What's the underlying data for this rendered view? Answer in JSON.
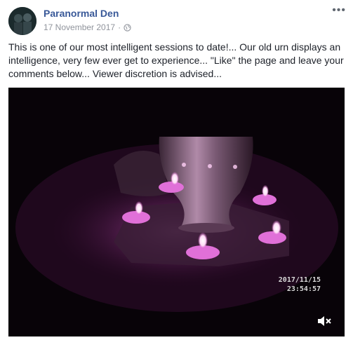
{
  "post": {
    "page_name": "Paranormal Den",
    "date": "17 November 2017",
    "separator": "·",
    "privacy_icon": "globe-icon",
    "more_icon": "more-dots-icon",
    "text": "This is one of our most intelligent sessions to date!... Our old urn displays an intelligence, very few ever get to experience... \"Like\" the page and leave your comments below... Viewer discretion is advised..."
  },
  "video": {
    "date_overlay": "2017/11/15",
    "time_overlay": "23:54:57",
    "mute_icon": "volume-muted-icon"
  },
  "colors": {
    "page_name": "#385898",
    "meta": "#90949c",
    "candle_glow": "#e060d0"
  }
}
